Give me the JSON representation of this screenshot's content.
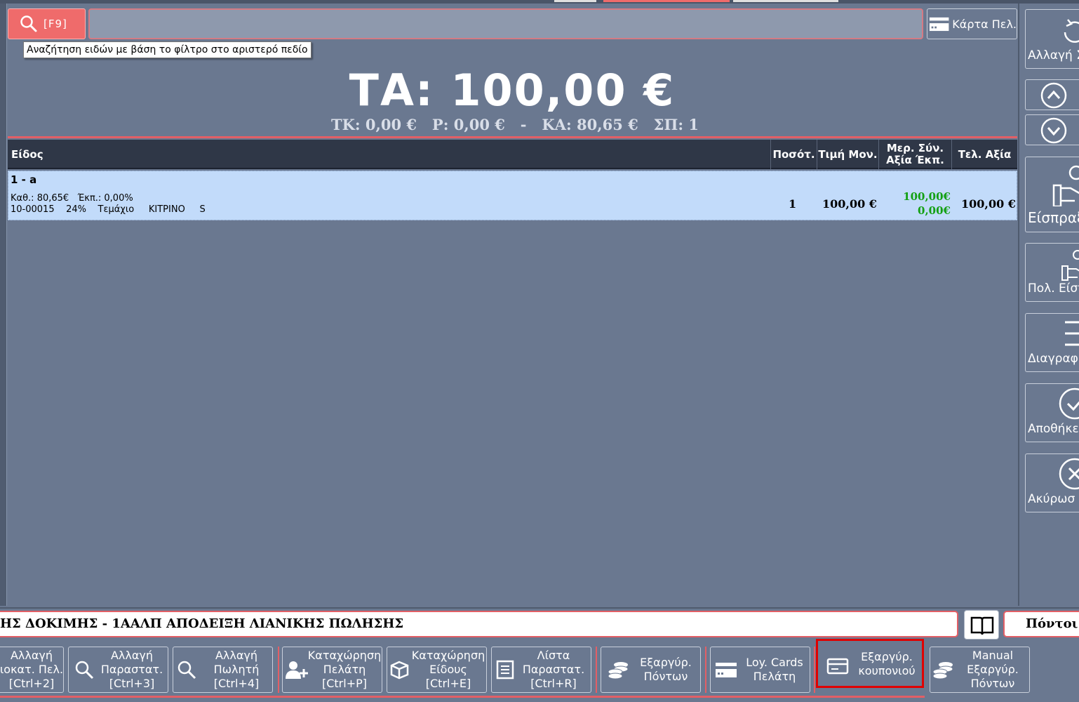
{
  "search": {
    "shortcut_label": "[F9]",
    "tooltip": "Αναζήτηση ειδών με βάση το φίλτρο στο αριστερό πεδίο",
    "value": ""
  },
  "customer_card_label": "Κάρτα Πελ.",
  "totals": {
    "main": "ΤΑ: 100,00 €",
    "secondary": "ΤΚ: 0,00 €   Ρ: 0,00 €   -   ΚΑ: 80,65 €   ΣΠ: 1"
  },
  "table": {
    "headers": {
      "item": "Είδος",
      "qty": "Ποσότ.",
      "unit_price": "Τιμή Μον.",
      "partial_1": "Μερ. Σύν.",
      "partial_2": "Αξία  Έκπ.",
      "final": "Τελ. Αξία"
    },
    "rows": [
      {
        "name": "1 - a",
        "meta_line1": "Καθ.: 80,65€   Έκπ.: 0,00%",
        "meta_line2": "10-00015    24%    Τεμάχιο     ΚΙΤΡΙΝΟ     S",
        "qty": "1",
        "unit_price": "100,00 €",
        "partial_value": "100,00€",
        "discount": "0,00€",
        "final_value": "100,00 €"
      }
    ]
  },
  "side_buttons": {
    "change": "Αλλαγή Σ",
    "receive": "Είσπραξ",
    "multi_receive": "Πολ. Είσπ",
    "delete": "Διαγραφ",
    "save": "Αποθήκευ",
    "cancel": "Ακύρωσ"
  },
  "document_type": "ΗΣ ΔΟΚΙΜΗΣ - 1ΑΑΛΠ ΑΠΟΔΕΙΞΗ ΛΙΑΝΙΚΗΣ ΠΩΛΗΣΗΣ",
  "points_label": "Πόντοι :",
  "function_buttons": {
    "b1": [
      "Αλλαγή",
      "ιοκατ. Πελ.",
      "[Ctrl+2]"
    ],
    "b2": [
      "Αλλαγή",
      "Παραστατ.",
      "[Ctrl+3]"
    ],
    "b3": [
      "Αλλαγή",
      "Πωλητή",
      "[Ctrl+4]"
    ],
    "b4": [
      "Καταχώρηση",
      "Πελάτη",
      "[Ctrl+P]"
    ],
    "b5": [
      "Καταχώρηση",
      "Είδους",
      "[Ctrl+E]"
    ],
    "b6": [
      "Λίστα",
      "Παραστατ.",
      "[Ctrl+R]"
    ],
    "b7": [
      "Εξαργύρ.",
      "Πόντων"
    ],
    "b8": [
      "Loy. Cards",
      "Πελάτη"
    ],
    "b9": [
      "Εξαργύρ.",
      "κουπονιού"
    ],
    "b10": [
      "Manual",
      "Εξαργύρ.",
      "Πόντων"
    ]
  },
  "colors": {
    "accent_red": "#ef6b6b",
    "row_selected": "#c2dbfa",
    "header_dark": "#2f3747",
    "background": "#6a7890",
    "highlight_border": "#e00000"
  }
}
